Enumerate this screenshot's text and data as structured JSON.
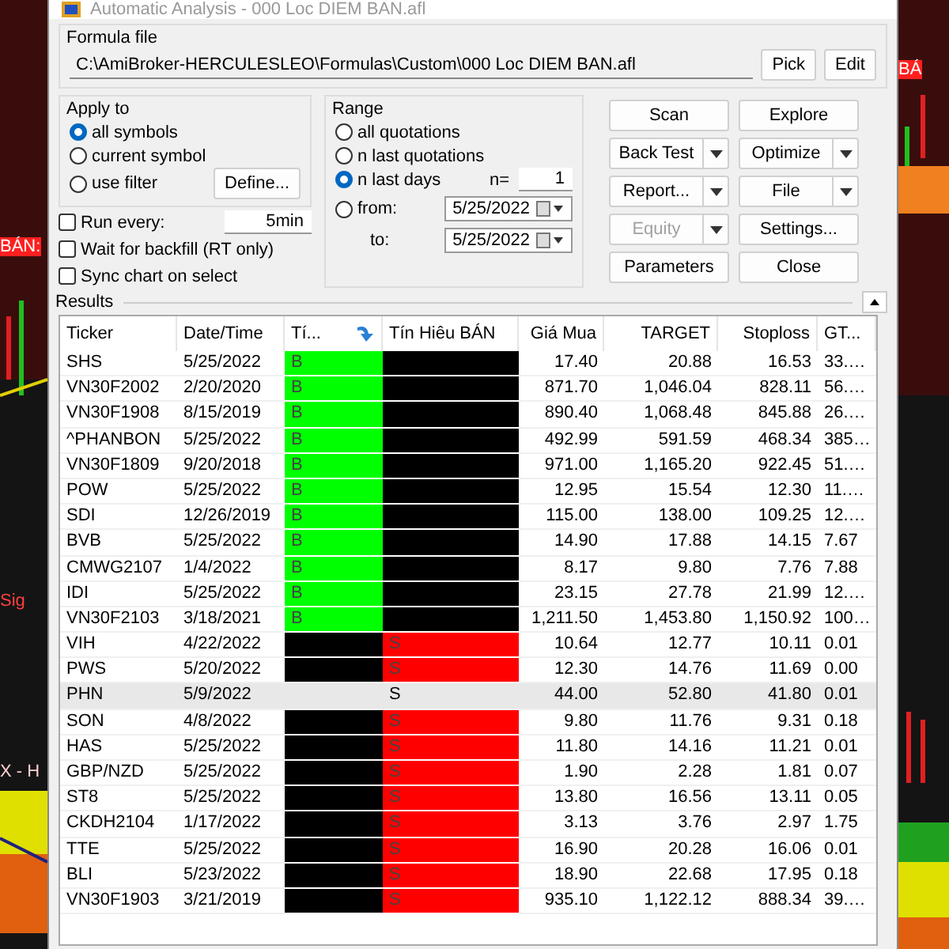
{
  "window": {
    "title": "Automatic Analysis - 000 Loc DIEM BAN.afl"
  },
  "background_chart": {
    "left_labels": [
      "BÁN:",
      "Sig",
      "X - H"
    ],
    "right_labels": [
      "BÁ"
    ]
  },
  "formula_file": {
    "label": "Formula file",
    "path": "C:\\AmiBroker-HERCULESLEO\\Formulas\\Custom\\000 Loc DIEM BAN.afl",
    "buttons": [
      "Pick",
      "Edit"
    ]
  },
  "apply_to": {
    "label": "Apply to",
    "options": [
      {
        "label": "all symbols",
        "selected": true
      },
      {
        "label": "current symbol",
        "selected": false
      },
      {
        "label": "use filter",
        "selected": false
      }
    ],
    "define_button": "Define..."
  },
  "options": [
    {
      "label": "Run every:",
      "checked": false,
      "value": "5min"
    },
    {
      "label": "Wait for backfill (RT only)",
      "checked": false
    },
    {
      "label": "Sync chart on select",
      "checked": false
    }
  ],
  "range": {
    "label": "Range",
    "options": [
      {
        "label": "all quotations",
        "selected": false
      },
      {
        "label": "n last quotations",
        "selected": false
      },
      {
        "label": "n last days",
        "selected": true
      },
      {
        "label": "from:",
        "selected": false
      }
    ],
    "n_label": "n=",
    "n_value": "1",
    "from": "5/25/2022",
    "to_label": "to:",
    "to": "5/25/2022"
  },
  "actions": [
    {
      "label": "Scan",
      "dropdown": false,
      "disabled": false
    },
    {
      "label": "Explore",
      "dropdown": false,
      "disabled": false
    },
    {
      "label": "Back Test",
      "dropdown": true,
      "disabled": false
    },
    {
      "label": "Optimize",
      "dropdown": true,
      "disabled": false
    },
    {
      "label": "Report...",
      "dropdown": true,
      "disabled": false
    },
    {
      "label": "File",
      "dropdown": true,
      "disabled": false
    },
    {
      "label": "Equity",
      "dropdown": true,
      "disabled": true
    },
    {
      "label": "Settings...",
      "dropdown": false,
      "disabled": false
    },
    {
      "label": "Parameters",
      "dropdown": false,
      "disabled": false
    },
    {
      "label": "Close",
      "dropdown": false,
      "disabled": false
    }
  ],
  "results": {
    "label": "Results",
    "columns": [
      "Ticker",
      "Date/Time",
      "Tí...",
      "Tín Hiêu BÁN",
      "Giá Mua",
      "TARGET",
      "Stoploss",
      "GT..."
    ],
    "rows": [
      {
        "ticker": "SHS",
        "date": "5/25/2022",
        "buy": {
          "text": "B",
          "color": "#00ff00"
        },
        "sell": {
          "color": "#000000"
        },
        "values": [
          "17.40",
          "20.88",
          "16.53",
          "33.…"
        ],
        "selected": false
      },
      {
        "ticker": "VN30F2002",
        "date": "2/20/2020",
        "buy": {
          "text": "B",
          "color": "#00ff00"
        },
        "sell": {
          "color": "#000000"
        },
        "values": [
          "871.70",
          "1,046.04",
          "828.11",
          "56.…"
        ],
        "selected": false
      },
      {
        "ticker": "VN30F1908",
        "date": "8/15/2019",
        "buy": {
          "text": "B",
          "color": "#00ff00"
        },
        "sell": {
          "color": "#000000"
        },
        "values": [
          "890.40",
          "1,068.48",
          "845.88",
          "26.…"
        ],
        "selected": false
      },
      {
        "ticker": "^PHANBON",
        "date": "5/25/2022",
        "buy": {
          "text": "B",
          "color": "#00ff00"
        },
        "sell": {
          "color": "#000000"
        },
        "values": [
          "492.99",
          "591.59",
          "468.34",
          "385…"
        ],
        "selected": false
      },
      {
        "ticker": "VN30F1809",
        "date": "9/20/2018",
        "buy": {
          "text": "B",
          "color": "#00ff00"
        },
        "sell": {
          "color": "#000000"
        },
        "values": [
          "971.00",
          "1,165.20",
          "922.45",
          "51.…"
        ],
        "selected": false
      },
      {
        "ticker": "POW",
        "date": "5/25/2022",
        "buy": {
          "text": "B",
          "color": "#00ff00"
        },
        "sell": {
          "color": "#000000"
        },
        "values": [
          "12.95",
          "15.54",
          "12.30",
          "11.…"
        ],
        "selected": false
      },
      {
        "ticker": "SDI",
        "date": "12/26/2019",
        "buy": {
          "text": "B",
          "color": "#00ff00"
        },
        "sell": {
          "color": "#000000"
        },
        "values": [
          "115.00",
          "138.00",
          "109.25",
          "12.…"
        ],
        "selected": false
      },
      {
        "ticker": "BVB",
        "date": "5/25/2022",
        "buy": {
          "text": "B",
          "color": "#00ff00"
        },
        "sell": {
          "color": "#000000"
        },
        "values": [
          "14.90",
          "17.88",
          "14.15",
          "7.67"
        ],
        "selected": false
      },
      {
        "ticker": "CMWG2107",
        "date": "1/4/2022",
        "buy": {
          "text": "B",
          "color": "#00ff00"
        },
        "sell": {
          "color": "#000000"
        },
        "values": [
          "8.17",
          "9.80",
          "7.76",
          "7.88"
        ],
        "selected": false
      },
      {
        "ticker": "IDI",
        "date": "5/25/2022",
        "buy": {
          "text": "B",
          "color": "#00ff00"
        },
        "sell": {
          "color": "#000000"
        },
        "values": [
          "23.15",
          "27.78",
          "21.99",
          "12.…"
        ],
        "selected": false
      },
      {
        "ticker": "VN30F2103",
        "date": "3/18/2021",
        "buy": {
          "text": "B",
          "color": "#00ff00"
        },
        "sell": {
          "color": "#000000"
        },
        "values": [
          "1,211.50",
          "1,453.80",
          "1,150.92",
          "100…"
        ],
        "selected": false
      },
      {
        "ticker": "VIH",
        "date": "4/22/2022",
        "buy": {
          "color": "#000000"
        },
        "sell": {
          "text": "S",
          "color": "#ff0000"
        },
        "values": [
          "10.64",
          "12.77",
          "10.11",
          "0.01"
        ],
        "selected": false
      },
      {
        "ticker": "PWS",
        "date": "5/20/2022",
        "buy": {
          "color": "#000000"
        },
        "sell": {
          "text": "S",
          "color": "#ff0000"
        },
        "values": [
          "12.30",
          "14.76",
          "11.69",
          "0.00"
        ],
        "selected": false
      },
      {
        "ticker": "PHN",
        "date": "5/9/2022",
        "buy": {},
        "sell": {
          "text": "S"
        },
        "values": [
          "44.00",
          "52.80",
          "41.80",
          "0.01"
        ],
        "selected": true
      },
      {
        "ticker": "SON",
        "date": "4/8/2022",
        "buy": {
          "color": "#000000"
        },
        "sell": {
          "text": "S",
          "color": "#ff0000"
        },
        "values": [
          "9.80",
          "11.76",
          "9.31",
          "0.18"
        ],
        "selected": false
      },
      {
        "ticker": "HAS",
        "date": "5/25/2022",
        "buy": {
          "color": "#000000"
        },
        "sell": {
          "text": "S",
          "color": "#ff0000"
        },
        "values": [
          "11.80",
          "14.16",
          "11.21",
          "0.01"
        ],
        "selected": false
      },
      {
        "ticker": "GBP/NZD",
        "date": "5/25/2022",
        "buy": {
          "color": "#000000"
        },
        "sell": {
          "text": "S",
          "color": "#ff0000"
        },
        "values": [
          "1.90",
          "2.28",
          "1.81",
          "0.07"
        ],
        "selected": false
      },
      {
        "ticker": "ST8",
        "date": "5/25/2022",
        "buy": {
          "color": "#000000"
        },
        "sell": {
          "text": "S",
          "color": "#ff0000"
        },
        "values": [
          "13.80",
          "16.56",
          "13.11",
          "0.05"
        ],
        "selected": false
      },
      {
        "ticker": "CKDH2104",
        "date": "1/17/2022",
        "buy": {
          "color": "#000000"
        },
        "sell": {
          "text": "S",
          "color": "#ff0000"
        },
        "values": [
          "3.13",
          "3.76",
          "2.97",
          "1.75"
        ],
        "selected": false
      },
      {
        "ticker": "TTE",
        "date": "5/25/2022",
        "buy": {
          "color": "#000000"
        },
        "sell": {
          "text": "S",
          "color": "#ff0000"
        },
        "values": [
          "16.90",
          "20.28",
          "16.06",
          "0.01"
        ],
        "selected": false
      },
      {
        "ticker": "BLI",
        "date": "5/23/2022",
        "buy": {
          "color": "#000000"
        },
        "sell": {
          "text": "S",
          "color": "#ff0000"
        },
        "values": [
          "18.90",
          "22.68",
          "17.95",
          "0.18"
        ],
        "selected": false
      },
      {
        "ticker": "VN30F1903",
        "date": "3/21/2019",
        "buy": {
          "color": "#000000"
        },
        "sell": {
          "text": "S",
          "color": "#ff0000"
        },
        "values": [
          "935.10",
          "1,122.12",
          "888.34",
          "39.…"
        ],
        "selected": false
      }
    ]
  }
}
